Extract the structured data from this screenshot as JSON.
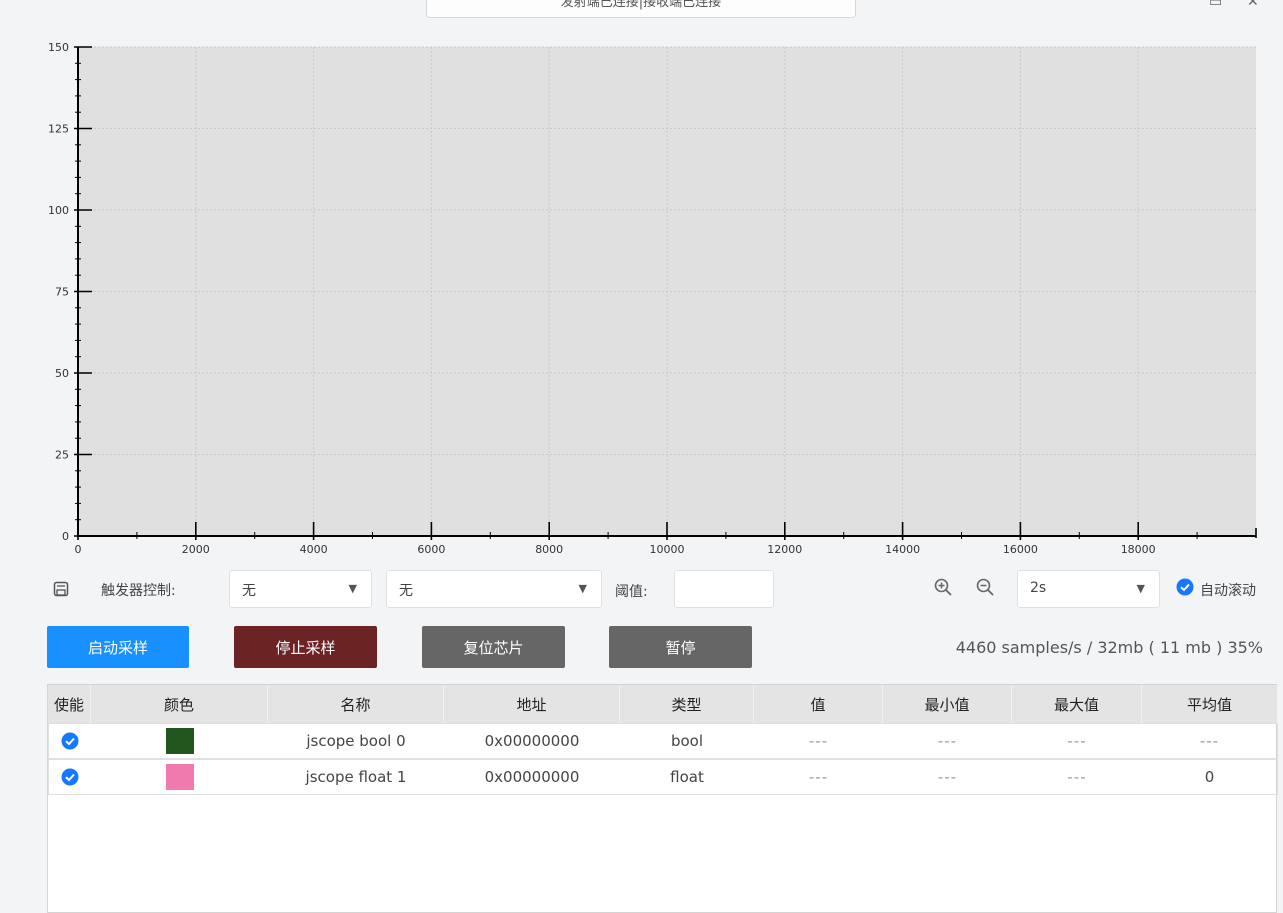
{
  "window": {
    "title": "发射端已连接|接收端已连接"
  },
  "chart": {
    "plot_bg": "#e0e0e0"
  },
  "chart_data": {
    "type": "line",
    "title": "",
    "xlabel": "",
    "ylabel": "",
    "xlim": [
      0,
      20000
    ],
    "ylim": [
      0,
      150
    ],
    "x_ticks": [
      "0",
      "2000",
      "4000",
      "6000",
      "8000",
      "10000",
      "12000",
      "14000",
      "16000",
      "18000"
    ],
    "y_ticks": [
      "0",
      "25",
      "50",
      "75",
      "100",
      "125",
      "150"
    ],
    "grid": true,
    "series": []
  },
  "trigger": {
    "save_icon": "save-icon",
    "label": "触发器控制:",
    "select1_value": "无",
    "select2_value": "无",
    "threshold_label": "阈值:",
    "threshold_value": "",
    "zoom_in_icon": "zoom-in-icon",
    "zoom_out_icon": "zoom-out-icon",
    "timebase_value": "2s",
    "auto_scroll_label": "自动滚动",
    "auto_scroll_checked": true
  },
  "buttons": {
    "start": "启动采样",
    "stop": "停止采样",
    "reset": "复位芯片",
    "pause": "暂停",
    "start_color": "#1890ff",
    "stop_color": "#6b2323",
    "reset_color": "#666666",
    "pause_color": "#666666"
  },
  "status": "4460 samples/s / 32mb ( 11 mb ) 35%",
  "table": {
    "headers": [
      "使能",
      "颜色",
      "名称",
      "地址",
      "类型",
      "值",
      "最小值",
      "最大值",
      "平均值"
    ],
    "rows": [
      {
        "enabled": true,
        "color": "#23561f",
        "name": "jscope bool 0",
        "address": "0x00000000",
        "type": "bool",
        "value": "---",
        "min": "---",
        "max": "---",
        "avg": "---"
      },
      {
        "enabled": true,
        "color": "#f07aae",
        "name": "jscope float 1",
        "address": "0x00000000",
        "type": "float",
        "value": "---",
        "min": "---",
        "max": "---",
        "avg": "0"
      }
    ]
  }
}
